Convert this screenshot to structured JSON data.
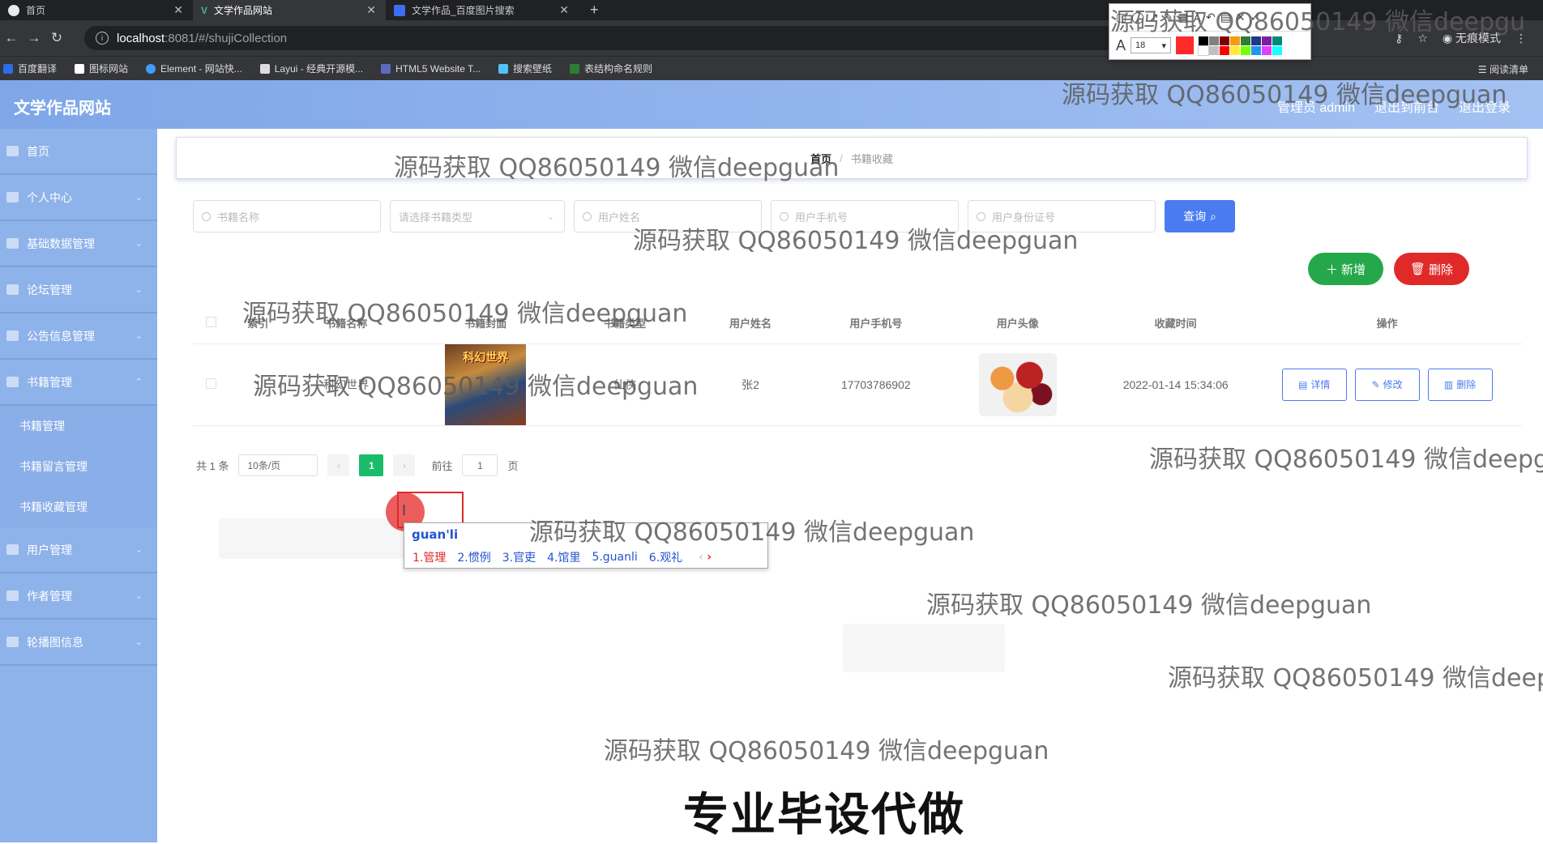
{
  "browser": {
    "tabs": [
      {
        "label": "首页",
        "icon": "github-icon"
      },
      {
        "label": "文学作品网站",
        "icon": "vue-icon"
      },
      {
        "label": "文学作品_百度图片搜索",
        "icon": "baidu-icon"
      }
    ],
    "new_tab": "+",
    "url_host": "localhost",
    "url_path": ":8081/#/shujiCollection",
    "incognito": "无痕模式",
    "bookmarks": [
      "百度翻译",
      "图标网站",
      "Element - 网站快...",
      "Layui - 经典开源模...",
      "HTML5 Website T...",
      "搜索壁纸",
      "表结构命名规则"
    ],
    "reading_list": "阅读清单"
  },
  "annot_toolbar": {
    "font_size": "18",
    "current_color": "#ff2a2a"
  },
  "app": {
    "site_title": "文学作品网站",
    "top_links": [
      "管理员 admin",
      "退出到前台",
      "退出登录"
    ],
    "sidebar": [
      {
        "label": "首页",
        "type": "item"
      },
      {
        "label": "个人中心",
        "type": "item"
      },
      {
        "label": "基础数据管理",
        "type": "item"
      },
      {
        "label": "论坛管理",
        "type": "item"
      },
      {
        "label": "公告信息管理",
        "type": "item"
      },
      {
        "label": "书籍管理",
        "type": "item"
      },
      {
        "label": "书籍管理",
        "type": "sub"
      },
      {
        "label": "书籍留言管理",
        "type": "sub"
      },
      {
        "label": "书籍收藏管理",
        "type": "sub"
      },
      {
        "label": "用户管理",
        "type": "item"
      },
      {
        "label": "作者管理",
        "type": "item"
      },
      {
        "label": "轮播图信息",
        "type": "item"
      }
    ],
    "breadcrumb": {
      "home": "首页",
      "sep": "/",
      "current": "书籍收藏"
    },
    "search": {
      "book_name": "书籍名称",
      "book_type": "请选择书籍类型",
      "user_name": "用户姓名",
      "user_phone": "用户手机号",
      "user_id": "用户身份证号",
      "query_btn": "查询"
    },
    "actions": {
      "add": "新增",
      "delete": "删除"
    },
    "table": {
      "headers": [
        "",
        "索引",
        "书籍名称",
        "书籍封面",
        "书籍类型",
        "用户姓名",
        "用户手机号",
        "用户头像",
        "收藏时间",
        "操作"
      ],
      "rows": [
        {
          "index": "1",
          "book_name": "科幻世界",
          "cover_text": "科幻世界",
          "book_type": "仙侠",
          "user_name": "张2",
          "phone": "17703786902",
          "time": "2022-01-14 15:34:06"
        }
      ],
      "ops": {
        "detail": "详情",
        "edit": "修改",
        "delete": "删除"
      }
    },
    "pager": {
      "total": "共 1 条",
      "page_size": "10条/页",
      "current": "1",
      "goto_label": "前往",
      "goto_value": "1",
      "page_unit": "页"
    }
  },
  "ime": {
    "composition": "guan'li",
    "candidates": [
      "1.管理",
      "2.惯例",
      "3.官吏",
      "4.馆里",
      "5.guanli",
      "6.观礼"
    ]
  },
  "watermarks": {
    "text": "源码获取 QQ86050149 微信deepguan",
    "text_cut": "源码获取 QQ86050149 微信deepgu",
    "text_cut2": "源码获取 QQ86050149 微信deep",
    "footer": "专业毕设代做"
  }
}
